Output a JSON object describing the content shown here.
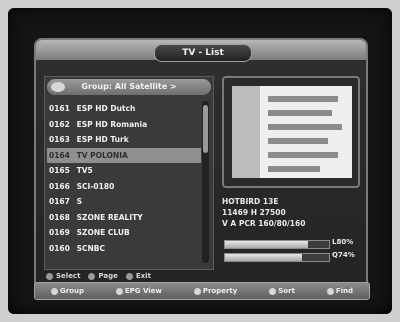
{
  "title": "TV - List",
  "group": {
    "label": "Group: All Satellite >"
  },
  "channels": [
    {
      "num": "0161",
      "name": "ESP HD Dutch"
    },
    {
      "num": "0162",
      "name": "ESP HD Romania"
    },
    {
      "num": "0163",
      "name": "ESP HD Turk"
    },
    {
      "num": "0164",
      "name": "TV POLONIA"
    },
    {
      "num": "0165",
      "name": "TV5"
    },
    {
      "num": "0166",
      "name": "SCI-0180"
    },
    {
      "num": "0167",
      "name": "S"
    },
    {
      "num": "0168",
      "name": "SZONE REALITY"
    },
    {
      "num": "0169",
      "name": "SZONE CLUB"
    },
    {
      "num": "0160",
      "name": "SCNBC"
    }
  ],
  "selected_index": 3,
  "info": {
    "satellite": "HOTBIRD 13E",
    "transponder": "11469 H 27500",
    "pids": "V A PCR 160/80/160"
  },
  "meters": {
    "strength_label": "L80%",
    "quality_label": "Q74%",
    "strength_value": 80,
    "quality_value": 74
  },
  "legend": {
    "select": "Select",
    "page": "Page",
    "exit": "Exit"
  },
  "functions": [
    {
      "label": "Group"
    },
    {
      "label": "EPG View"
    },
    {
      "label": "Property"
    },
    {
      "label": "Sort"
    },
    {
      "label": "Find"
    }
  ]
}
